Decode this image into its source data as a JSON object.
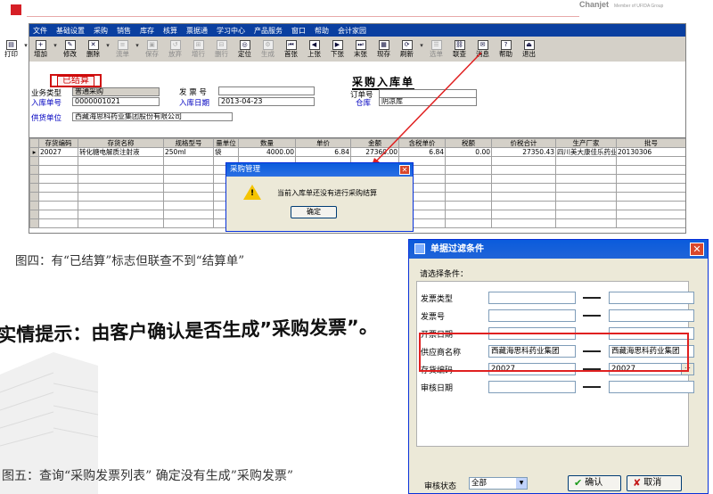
{
  "brand": {
    "name": "Chanjet",
    "sub": "Member of UFIDA Group"
  },
  "app": {
    "menu": [
      "文件",
      "基础设置",
      "采购",
      "销售",
      "库存",
      "核算",
      "票据通",
      "学习中心",
      "产品服务",
      "窗口",
      "帮助",
      "会计家园"
    ],
    "toolbar": [
      {
        "label": "打印",
        "icon": "printer-icon",
        "enabled": true
      },
      {
        "label": "增加",
        "icon": "add-icon",
        "enabled": true
      },
      {
        "label": "修改",
        "icon": "edit-icon",
        "enabled": true
      },
      {
        "label": "删除",
        "icon": "delete-icon",
        "enabled": true
      },
      {
        "label": "流单",
        "icon": "flow-icon",
        "enabled": false
      },
      {
        "label": "保存",
        "icon": "save-icon",
        "enabled": false
      },
      {
        "label": "放弃",
        "icon": "discard-icon",
        "enabled": false
      },
      {
        "label": "增行",
        "icon": "add-row-icon",
        "enabled": false
      },
      {
        "label": "删行",
        "icon": "delete-row-icon",
        "enabled": false
      },
      {
        "label": "定位",
        "icon": "locate-icon",
        "enabled": true
      },
      {
        "label": "生成",
        "icon": "generate-icon",
        "enabled": false
      },
      {
        "label": "首张",
        "icon": "first-icon",
        "enabled": true
      },
      {
        "label": "上张",
        "icon": "prev-icon",
        "enabled": true
      },
      {
        "label": "下张",
        "icon": "next-icon",
        "enabled": true
      },
      {
        "label": "末张",
        "icon": "last-icon",
        "enabled": true
      },
      {
        "label": "现存",
        "icon": "stock-icon",
        "enabled": true
      },
      {
        "label": "刷新",
        "icon": "refresh-icon",
        "enabled": true
      },
      {
        "label": "选单",
        "icon": "select-icon",
        "enabled": false
      },
      {
        "label": "联查",
        "icon": "link-query-icon",
        "enabled": true
      },
      {
        "label": "消息",
        "icon": "message-icon",
        "enabled": true
      },
      {
        "label": "帮助",
        "icon": "help-icon",
        "enabled": true
      },
      {
        "label": "退出",
        "icon": "exit-icon",
        "enabled": true
      }
    ]
  },
  "doc": {
    "settled_badge": "已结算",
    "title": "采购入库单",
    "biz_type_label": "业务类型",
    "biz_type": "普通采购",
    "invoice_no_label": "发 票 号",
    "invoice_no": "",
    "order_no_label": "订单号",
    "order_no": "",
    "inbound_no_label": "入库单号",
    "inbound_no": "0000001021",
    "inbound_date_label": "入库日期",
    "inbound_date": "2013-04-23",
    "warehouse_label": "仓库",
    "warehouse": "阴凉库",
    "supplier_label": "供货单位",
    "supplier": "西藏海思科药业集团股份有限公司"
  },
  "grid": {
    "columns": [
      "存货编码",
      "存货名称",
      "规格型号",
      "量单位",
      "数量",
      "单价",
      "金额",
      "含税单价",
      "税额",
      "价税合计",
      "生产厂家",
      "批号"
    ],
    "rows": [
      [
        "20027",
        "转化糖电解质注射液",
        "250ml",
        "袋",
        "4000.00",
        "6.84",
        "27360.00",
        "6.84",
        "0.00",
        "27350.43",
        "四川美大康佳乐药业",
        "20130306"
      ]
    ],
    "empty_rows": 8
  },
  "dlg1": {
    "title": "采购管理",
    "message": "当前入库单还没有进行采购结算",
    "ok": "确定"
  },
  "captions": {
    "fig4": "图四：有“已结算”标志但联查不到“结算单”",
    "tip": "实情提示：由客户确认是否生成”采购发票”。",
    "fig5": "图五：查询“采购发票列表” 确定没有生成”采购发票”"
  },
  "dlg2": {
    "title": "单据过滤条件",
    "prompt": "请选择条件：",
    "conditions": [
      {
        "label": "发票类型",
        "from": "",
        "to": ""
      },
      {
        "label": "发票号",
        "from": "",
        "to": ""
      },
      {
        "label": "开票日期",
        "from": "",
        "to": ""
      },
      {
        "label": "供应商名称",
        "from": "西藏海思科药业集团",
        "to": "西藏海思科药业集团"
      },
      {
        "label": "存货编码",
        "from": "20027",
        "to": "20027"
      },
      {
        "label": "审核日期",
        "from": "",
        "to": ""
      }
    ],
    "audit_label": "审核状态",
    "audit_value": "全部",
    "ok": "确认",
    "cancel": "取消"
  }
}
